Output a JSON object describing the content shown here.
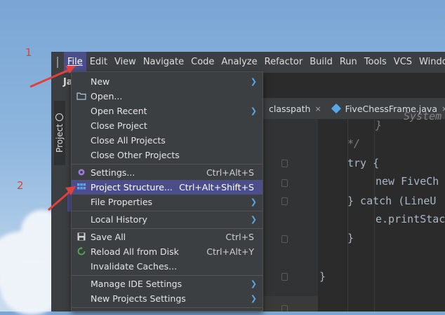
{
  "annotations": {
    "step1": "1",
    "step2": "2"
  },
  "menubar": {
    "items": [
      "File",
      "Edit",
      "View",
      "Navigate",
      "Code",
      "Analyze",
      "Refactor",
      "Build",
      "Run",
      "Tools",
      "VCS",
      "Windo"
    ]
  },
  "sidebar": {
    "title": "Ja",
    "project_tab": "Project"
  },
  "tabs": [
    {
      "label": "classpath",
      "close": "×"
    },
    {
      "label": "FiveChessFrame.java",
      "close": "×"
    }
  ],
  "editor": {
    "lines": [
      "System",
      "}",
      "*/",
      "try {",
      "new FiveCh",
      "} catch (LineU",
      "e.printStac",
      "}",
      "}"
    ]
  },
  "file_menu": {
    "items": [
      {
        "label": "New",
        "shortcut": "",
        "submenu": true
      },
      {
        "label": "Open...",
        "shortcut": "",
        "submenu": false
      },
      {
        "label": "Open Recent",
        "shortcut": "",
        "submenu": true
      },
      {
        "label": "Close Project",
        "shortcut": "",
        "submenu": false
      },
      {
        "label": "Close All Projects",
        "shortcut": "",
        "submenu": false
      },
      {
        "label": "Close Other Projects",
        "shortcut": "",
        "submenu": false
      },
      {
        "label": "Settings...",
        "shortcut": "Ctrl+Alt+S",
        "submenu": false
      },
      {
        "label": "Project Structure...",
        "shortcut": "Ctrl+Alt+Shift+S",
        "submenu": false
      },
      {
        "label": "File Properties",
        "shortcut": "",
        "submenu": true
      },
      {
        "label": "Local History",
        "shortcut": "",
        "submenu": true
      },
      {
        "label": "Save All",
        "shortcut": "Ctrl+S",
        "submenu": false
      },
      {
        "label": "Reload All from Disk",
        "shortcut": "Ctrl+Alt+Y",
        "submenu": false
      },
      {
        "label": "Invalidate Caches...",
        "shortcut": "",
        "submenu": false
      },
      {
        "label": "Manage IDE Settings",
        "shortcut": "",
        "submenu": true
      },
      {
        "label": "New Projects Settings",
        "shortcut": "",
        "submenu": true
      }
    ]
  },
  "colors": {
    "accent": "#4b4e88",
    "arrow": "#e0413a",
    "icon_blue": "#58a7e6"
  }
}
